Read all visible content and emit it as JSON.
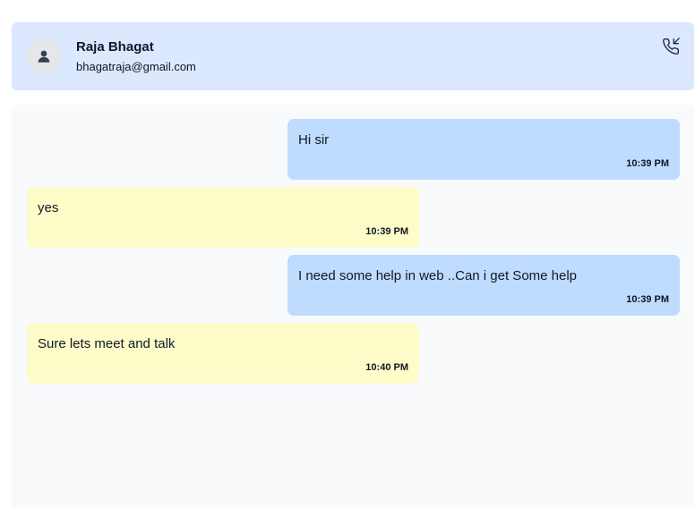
{
  "contact": {
    "name": "Raja Bhagat",
    "email": "bhagatraja@gmail.com",
    "avatar_icon": "user-icon",
    "call_icon": "phone-incoming-icon"
  },
  "colors": {
    "header_bg": "#dbe8fe",
    "outgoing_bubble": "#bfdbfe",
    "incoming_bubble": "#fefcc8",
    "chat_bg": "#f8fafc"
  },
  "messages": [
    {
      "direction": "outgoing",
      "text": "Hi sir",
      "time": "10:39 PM"
    },
    {
      "direction": "incoming",
      "text": "yes",
      "time": "10:39 PM"
    },
    {
      "direction": "outgoing",
      "text": "I need some help in web ..Can i get Some help",
      "time": "10:39 PM"
    },
    {
      "direction": "incoming",
      "text": "Sure lets meet and talk",
      "time": "10:40 PM"
    }
  ]
}
